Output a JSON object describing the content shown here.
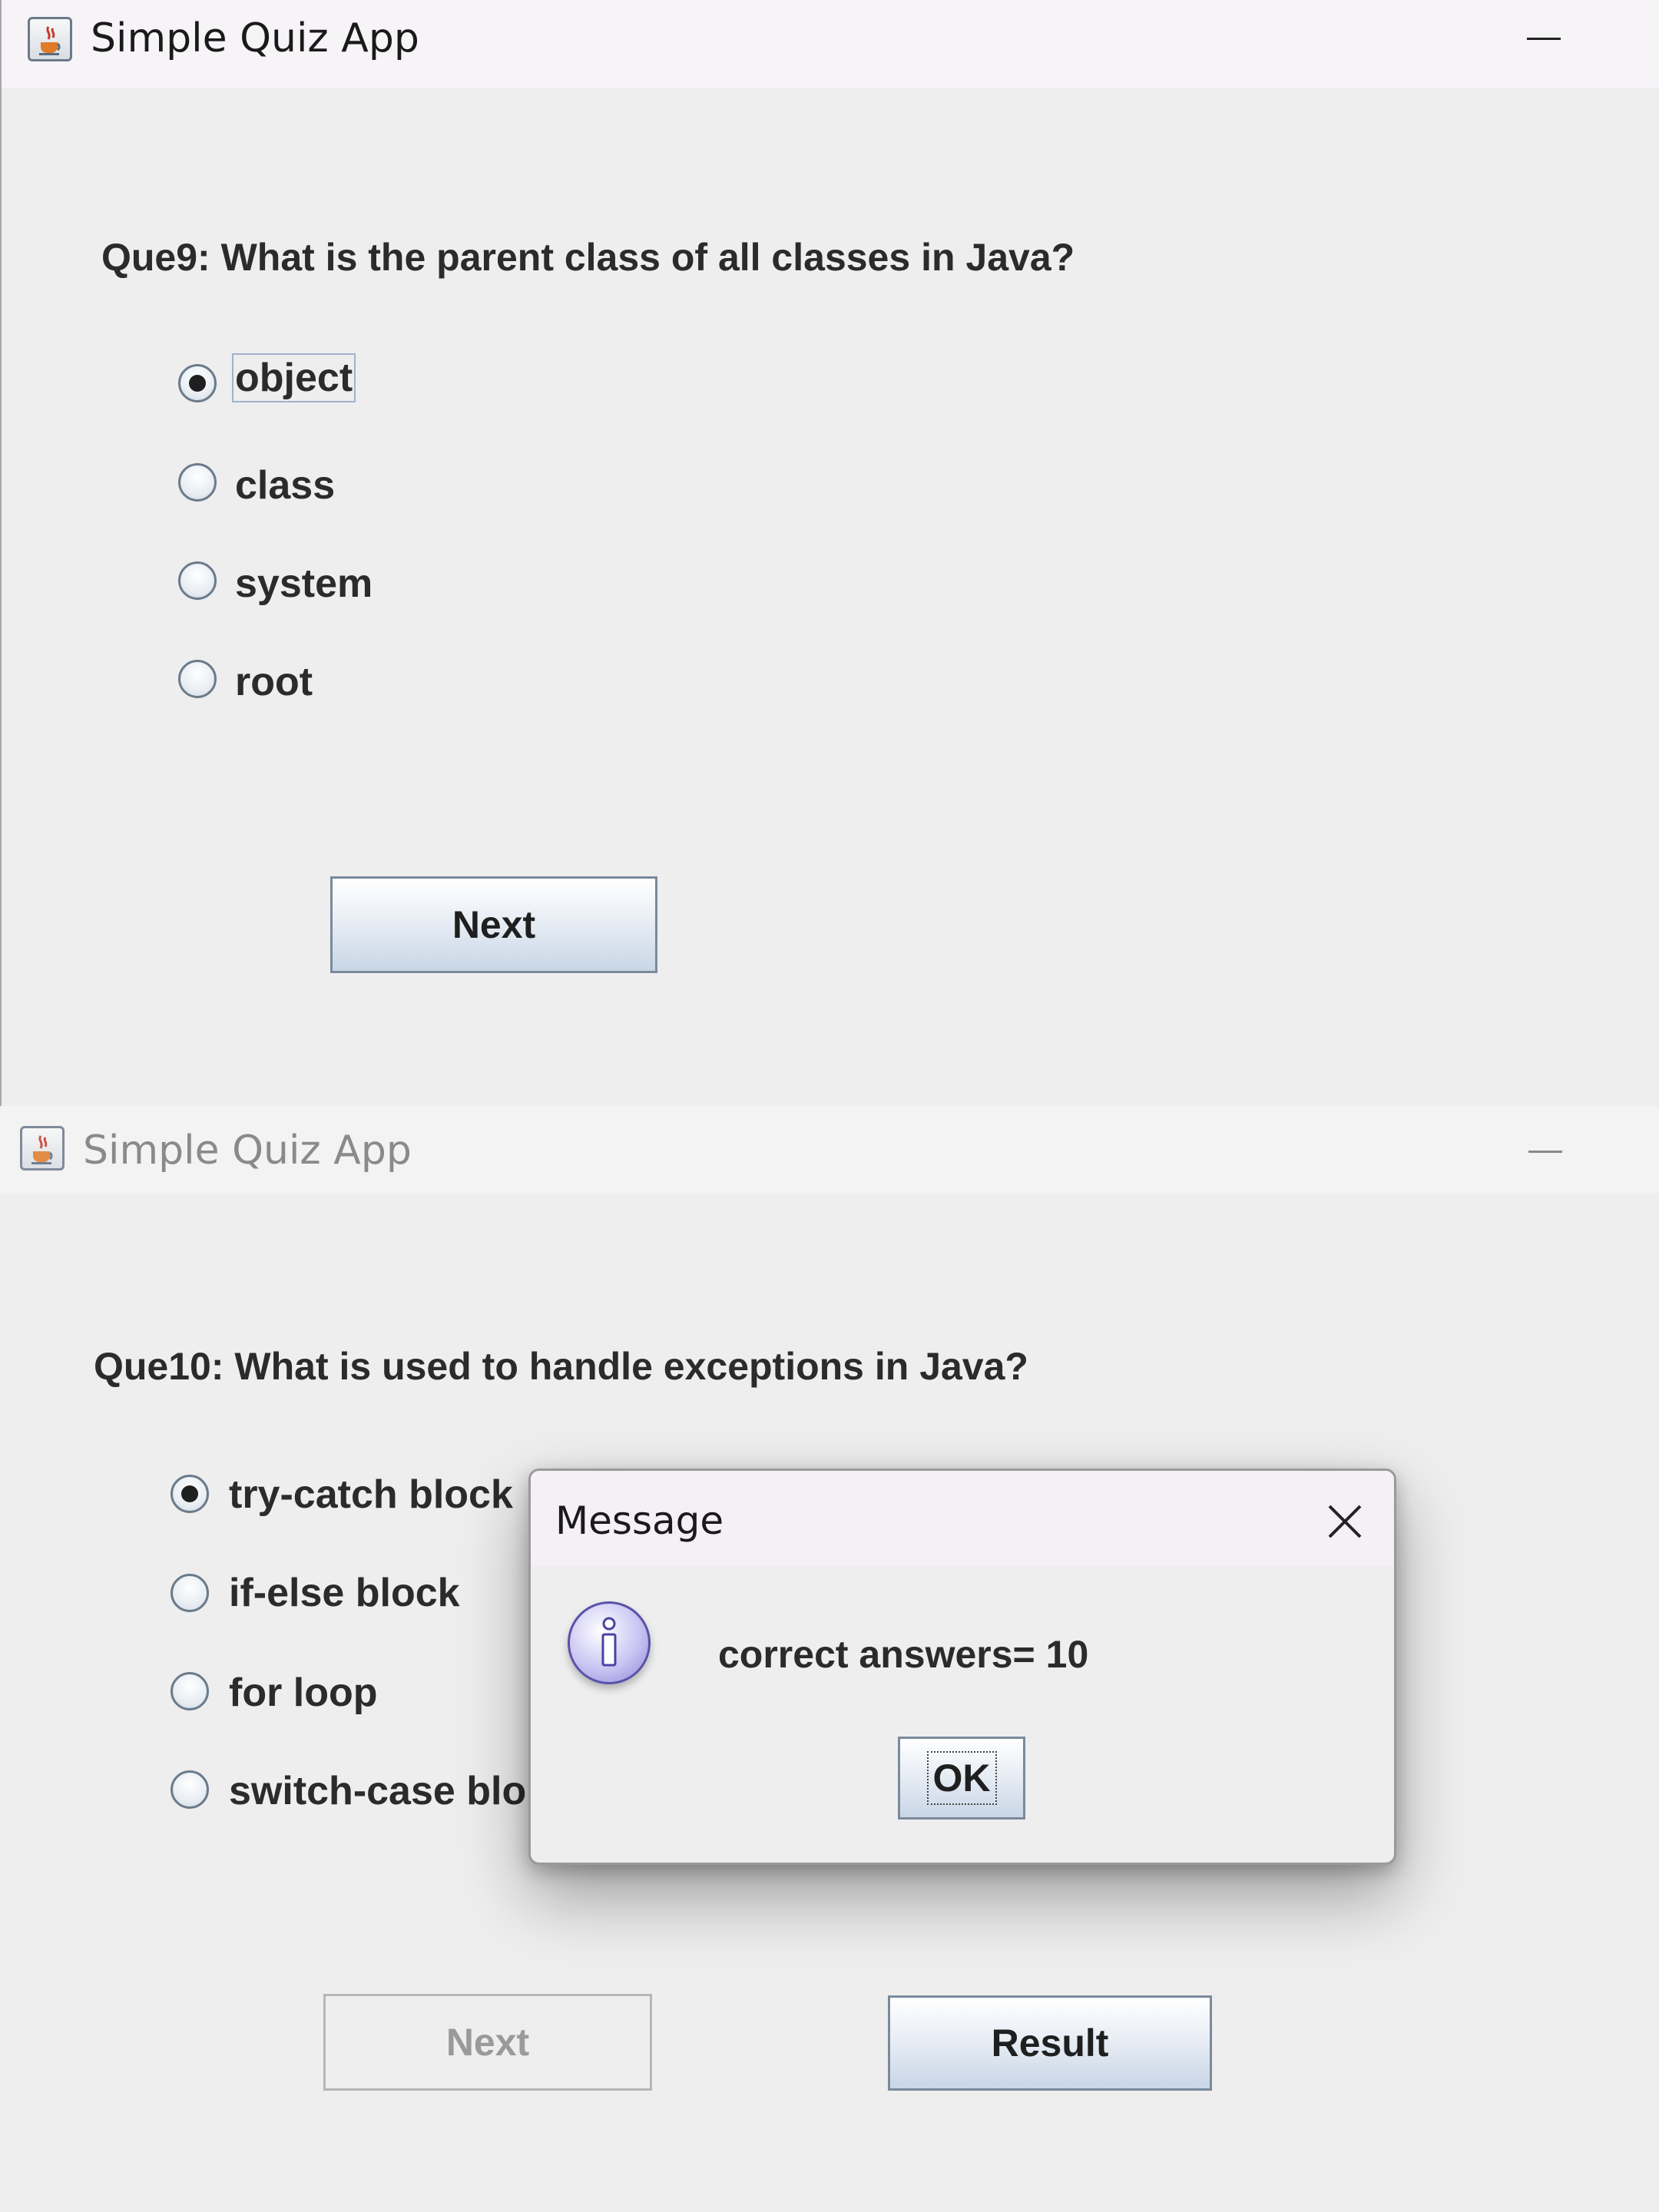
{
  "windows": [
    {
      "title": "Simple Quiz App",
      "question": "Que9: What is the parent class of all classes in Java?",
      "options": [
        {
          "label": "object",
          "selected": true
        },
        {
          "label": "class",
          "selected": false
        },
        {
          "label": "system",
          "selected": false
        },
        {
          "label": "root",
          "selected": false
        }
      ],
      "next_label": "Next"
    },
    {
      "title": "Simple Quiz App",
      "question": "Que10: What is used to handle exceptions in Java?",
      "options": [
        {
          "label": "try-catch block",
          "selected": true
        },
        {
          "label": "if-else block",
          "selected": false
        },
        {
          "label": "for loop",
          "selected": false
        },
        {
          "label": "switch-case blo",
          "selected": false
        }
      ],
      "next_label": "Next",
      "result_label": "Result"
    }
  ],
  "dialog": {
    "title": "Message",
    "message": "correct answers= 10",
    "ok_label": "OK",
    "icon": "info-icon"
  },
  "icons": {
    "app": "java-cup-icon",
    "minimize": "minimize-icon",
    "close": "close-icon"
  },
  "colors": {
    "window_bg": "#eeeeee",
    "button_gradient_bottom": "#c8d6e6",
    "info_icon": "#8f86d8"
  }
}
